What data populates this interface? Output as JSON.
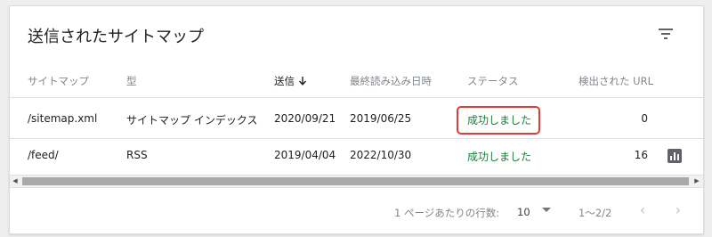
{
  "title": "送信されたサイトマップ",
  "filter_icon": "filter-list-icon",
  "columns": [
    {
      "label": "サイトマップ"
    },
    {
      "label": "型"
    },
    {
      "label": "送信",
      "sorted": "desc",
      "sort_icon": "arrow-down-icon"
    },
    {
      "label": "最終読み込み日時"
    },
    {
      "label": "ステータス"
    },
    {
      "label": "検出された URL"
    }
  ],
  "rows": [
    {
      "sitemap": "/sitemap.xml",
      "type": "サイトマップ インデックス",
      "submitted": "2020/09/21",
      "last_read": "2019/06/25",
      "status": "成功しました",
      "urls": "0",
      "highlighted": true
    },
    {
      "sitemap": "/feed/",
      "type": "RSS",
      "submitted": "2019/04/04",
      "last_read": "2022/10/30",
      "status": "成功しました",
      "urls": "16",
      "action_icon": "bar-chart-icon"
    }
  ],
  "pagination": {
    "rows_per_page_label": "1 ページあたりの行数:",
    "rows_per_page_value": "10",
    "range": "1〜2/2",
    "prev_icon": "chevron-left-icon",
    "next_icon": "chevron-right-icon"
  },
  "colors": {
    "status_success": "#188038",
    "highlight": "#e53935"
  }
}
